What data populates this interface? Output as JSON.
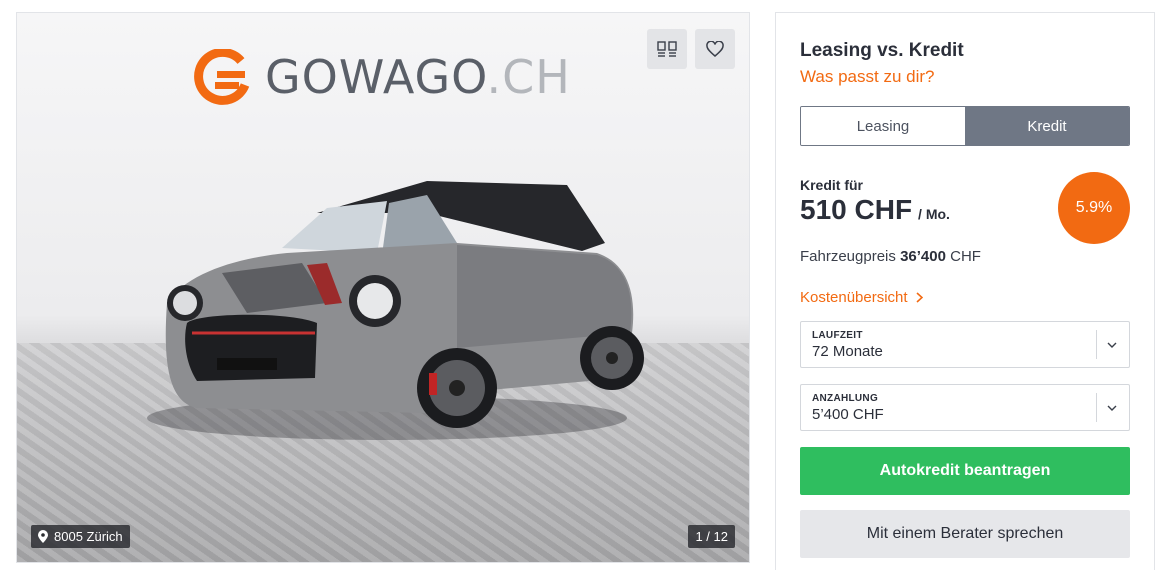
{
  "gallery": {
    "logo_text": "GOWAGO",
    "logo_tld": ".CH",
    "location": "8005 Zürich",
    "counter": "1 / 12",
    "compare_icon": "compare-icon",
    "favorite_icon": "heart-icon",
    "location_icon": "map-pin-icon"
  },
  "finance": {
    "title": "Leasing vs. Kredit",
    "subtitle": "Was passt zu dir?",
    "tabs": [
      {
        "label": "Leasing",
        "active": false
      },
      {
        "label": "Kredit",
        "active": true
      }
    ],
    "kredit_label": "Kredit für",
    "monthly_price": "510 CHF",
    "price_unit": "/ Mo.",
    "rate": "5.9%",
    "vehicle_price_label": "Fahrzeugpreis",
    "vehicle_price_value": "36’400",
    "vehicle_price_currency": "CHF",
    "cost_overview_link": "Kostenübersicht",
    "laufzeit": {
      "label": "LAUFZEIT",
      "value": "72 Monate"
    },
    "anzahlung": {
      "label": "ANZAHLUNG",
      "value": "5’400 CHF"
    },
    "primary_button": "Autokredit beantragen",
    "secondary_button": "Mit einem Berater sprechen"
  },
  "colors": {
    "accent_orange": "#f26a12",
    "primary_green": "#2fbe5f",
    "toggle_active": "#6f7785",
    "secondary_gray": "#e6e7ea"
  }
}
